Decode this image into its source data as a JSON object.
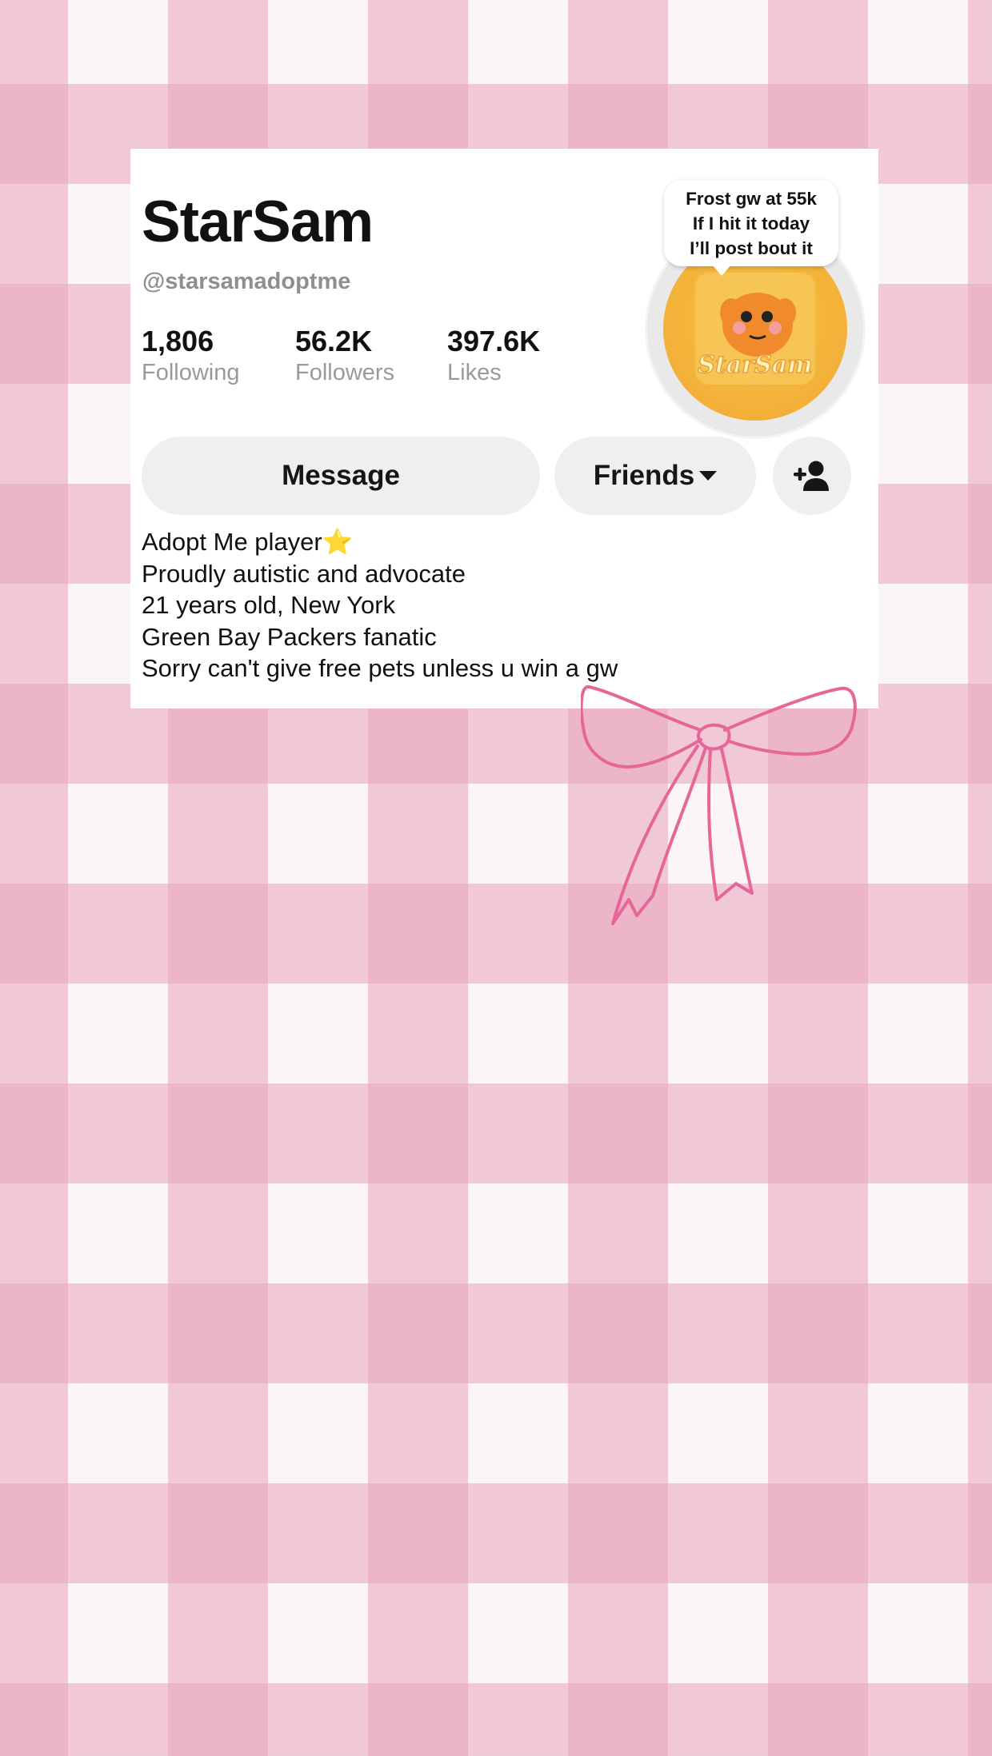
{
  "profile": {
    "display_name": "StarSam",
    "handle": "@starsamadoptme",
    "stats": {
      "following": {
        "value": "1,806",
        "label": "Following"
      },
      "followers": {
        "value": "56.2K",
        "label": "Followers"
      },
      "likes": {
        "value": "397.6K",
        "label": "Likes"
      }
    },
    "buttons": {
      "message": "Message",
      "friends": "Friends",
      "add_friend_icon": "add-person-icon",
      "friends_dropdown_icon": "caret-down-icon"
    },
    "bio_lines": [
      "Adopt Me player⭐",
      "Proudly autistic and advocate",
      "21 years old, New York",
      "Green Bay Packers fanatic",
      "Sorry can't give free pets unless u win a gw"
    ],
    "avatar": {
      "icon": "pet-avatar-icon",
      "logo_text": "StarSam"
    },
    "note_bubble": {
      "lines": [
        "Frost gw at 55k",
        "If I hit it today",
        "I’ll post bout it"
      ]
    }
  },
  "colors": {
    "gingham": "#e8a5bc",
    "bow": "#e6669a",
    "button_bg": "#efefef",
    "avatar_bg": "#f4b43a"
  }
}
